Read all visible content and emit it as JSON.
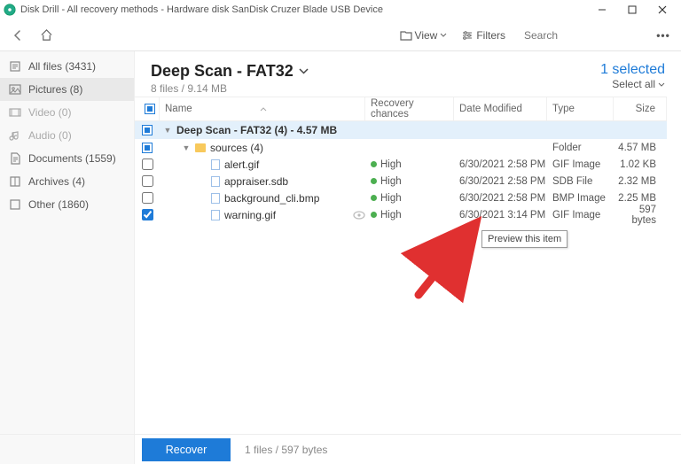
{
  "window": {
    "title": "Disk Drill - All recovery methods - Hardware disk SanDisk Cruzer Blade USB Device"
  },
  "toolbar": {
    "view_label": "View",
    "filters_label": "Filters",
    "search_placeholder": "Search"
  },
  "sidebar": {
    "items": [
      {
        "label": "All files (3431)",
        "icon": "files"
      },
      {
        "label": "Pictures (8)",
        "icon": "pictures",
        "selected": true
      },
      {
        "label": "Video (0)",
        "icon": "video"
      },
      {
        "label": "Audio (0)",
        "icon": "audio"
      },
      {
        "label": "Documents (1559)",
        "icon": "documents"
      },
      {
        "label": "Archives (4)",
        "icon": "archives"
      },
      {
        "label": "Other (1860)",
        "icon": "other"
      }
    ]
  },
  "header": {
    "title": "Deep Scan - FAT32",
    "subtitle": "8 files / 9.14 MB",
    "selected_text": "1 selected",
    "select_all_label": "Select all"
  },
  "columns": {
    "name": "Name",
    "recovery": "Recovery chances",
    "date": "Date Modified",
    "type": "Type",
    "size": "Size"
  },
  "group_row": {
    "label": "Deep Scan - FAT32 (4) - 4.57 MB"
  },
  "rows": [
    {
      "indent": 1,
      "expand": true,
      "folder": true,
      "name": "sources (4)",
      "recovery": "",
      "date": "",
      "type": "Folder",
      "size": "4.57 MB",
      "checked": "tri"
    },
    {
      "indent": 2,
      "file": true,
      "name": "alert.gif",
      "recovery": "High",
      "date": "6/30/2021 2:58 PM",
      "type": "GIF Image",
      "size": "1.02 KB",
      "checked": "off"
    },
    {
      "indent": 2,
      "file": true,
      "name": "appraiser.sdb",
      "recovery": "High",
      "date": "6/30/2021 2:58 PM",
      "type": "SDB File",
      "size": "2.32 MB",
      "checked": "off"
    },
    {
      "indent": 2,
      "file": true,
      "name": "background_cli.bmp",
      "recovery": "High",
      "date": "6/30/2021 2:58 PM",
      "type": "BMP Image",
      "size": "2.25 MB",
      "checked": "off"
    },
    {
      "indent": 2,
      "file": true,
      "name": "warning.gif",
      "recovery": "High",
      "date": "6/30/2021 3:14 PM",
      "type": "GIF Image",
      "size": "597 bytes",
      "checked": "on",
      "preview": true
    }
  ],
  "tooltip": "Preview this item",
  "footer": {
    "recover_label": "Recover",
    "status": "1 files / 597 bytes"
  }
}
